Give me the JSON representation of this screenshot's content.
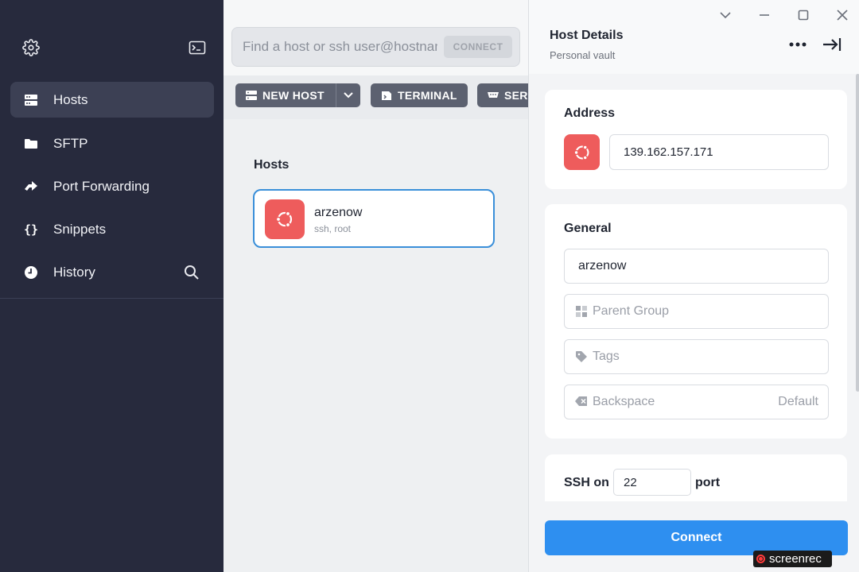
{
  "sidebar": {
    "items": [
      {
        "label": "Hosts",
        "icon": "server-icon"
      },
      {
        "label": "SFTP",
        "icon": "folder-icon"
      },
      {
        "label": "Port Forwarding",
        "icon": "arrow-forward-icon"
      },
      {
        "label": "Snippets",
        "icon": "braces-icon"
      },
      {
        "label": "History",
        "icon": "clock-icon"
      }
    ],
    "active": "Hosts"
  },
  "search": {
    "placeholder": "Find a host or ssh user@hostname",
    "connect_label": "CONNECT"
  },
  "toolbar": {
    "new_host_label": "NEW HOST",
    "terminal_label": "TERMINAL",
    "serial_label": "SERIAL"
  },
  "hosts": {
    "heading": "Hosts",
    "items": [
      {
        "name": "arzenow",
        "sub": "ssh, root",
        "os": "ubuntu"
      }
    ]
  },
  "panel": {
    "title": "Host Details",
    "subtitle": "Personal vault",
    "address": {
      "title": "Address",
      "value": "139.162.157.171"
    },
    "general": {
      "title": "General",
      "label_value": "arzenow",
      "parent_group_placeholder": "Parent Group",
      "tags_placeholder": "Tags",
      "backspace_label": "Backspace",
      "backspace_value": "Default"
    },
    "ssh": {
      "prefix": "SSH on",
      "port": "22",
      "suffix": "port"
    },
    "connect_label": "Connect"
  },
  "watermark": {
    "text": "screenrec"
  },
  "colors": {
    "sidebar_bg": "#272a3d",
    "accent": "#2e8ff0",
    "ubuntu": "#ee5c5c"
  }
}
